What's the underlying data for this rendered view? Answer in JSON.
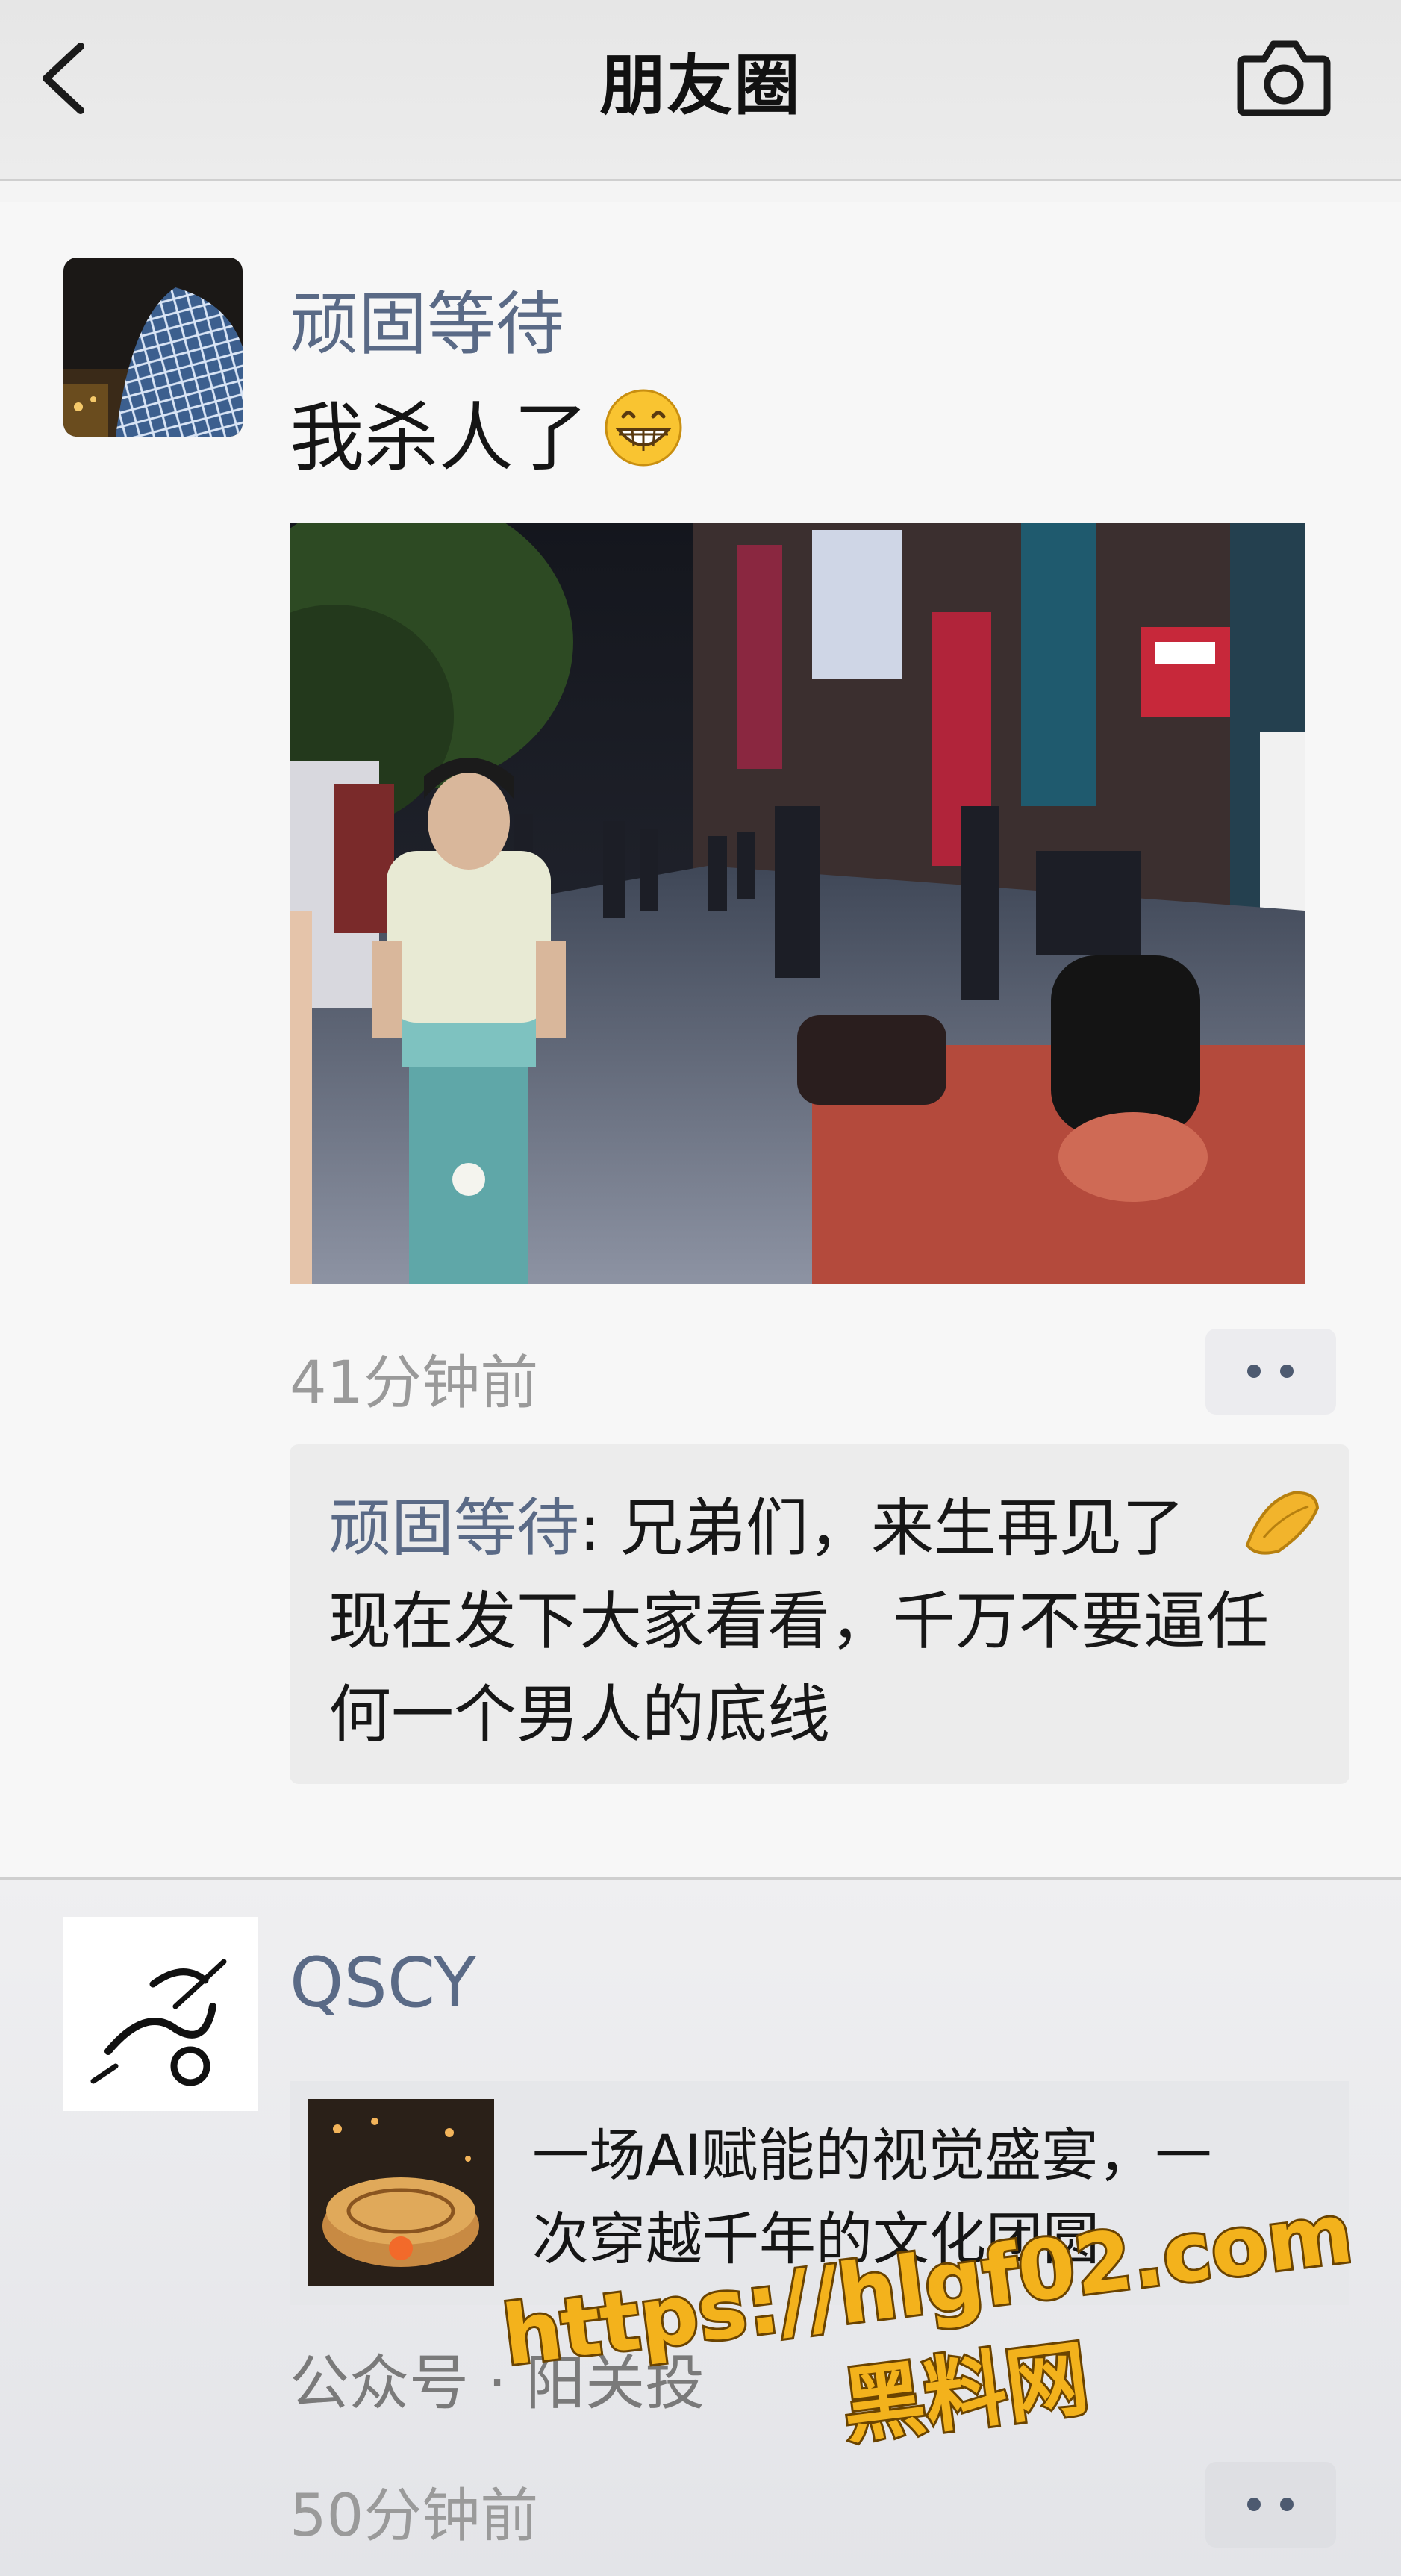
{
  "header": {
    "title": "朋友圈",
    "back_icon": "chevron-left-icon",
    "camera_icon": "camera-icon"
  },
  "posts": [
    {
      "author": "顽固等待",
      "text": "我杀人了",
      "emoji": "grinning-face-icon",
      "time": "41分钟前",
      "comment": {
        "commenter": "顽固等待",
        "lines": [
          ": 兄弟们，来生再见了",
          "现在发下大家看看，千万不要逼任",
          "何一个男人的底线"
        ],
        "emoji": "bye-hand-icon"
      }
    },
    {
      "author": "QSCY",
      "card_lines": [
        "一场AI赋能的视觉盛宴，一",
        "次穿越千年的文化团圆"
      ],
      "source": "公众号 · 阳关投",
      "time": "50分钟前"
    }
  ],
  "watermark": {
    "url": "https://hlgf02.com",
    "name": "黑料网",
    "color": "#f3b21c"
  },
  "colors": {
    "name_blue": "#5a6a86",
    "text_gray": "#9a9a9a"
  }
}
